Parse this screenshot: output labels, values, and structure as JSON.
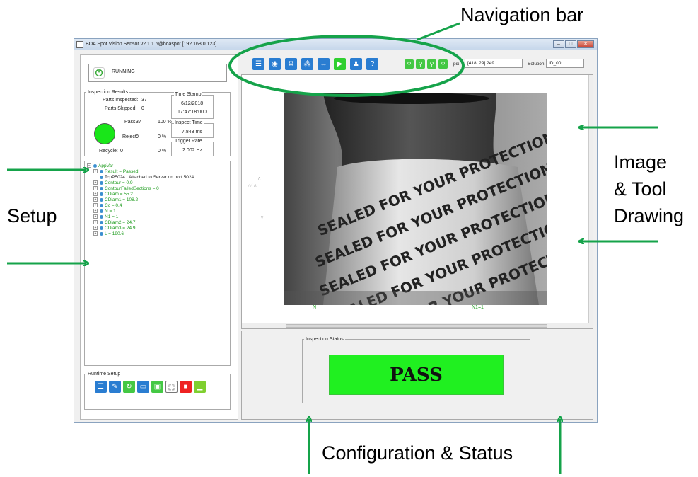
{
  "annotations": {
    "nav_bar": "Navigation bar",
    "setup": "Setup",
    "image_line1": "Image",
    "image_line2": "& Tool",
    "image_line3": "Drawing",
    "config": "Configuration & Status"
  },
  "window": {
    "title": "BOA Spot Vision Sensor v2.1.1.6@boaspot [192.168.0.123]"
  },
  "run": {
    "status": "RUNNING"
  },
  "inspection_results": {
    "legend": "Inspection Results",
    "parts_inspected_label": "Parts Inspected:",
    "parts_inspected": "37",
    "parts_skipped_label": "Parts Skipped:",
    "parts_skipped": "0",
    "pass_label": "Pass:",
    "pass_count": "37",
    "pass_pct": "100 %",
    "reject_label": "Reject:",
    "reject_count": "0",
    "reject_pct": "0 %",
    "recycle_label": "Recycle:",
    "recycle_count": "0",
    "recycle_pct": "0 %",
    "status_color": "#19e619",
    "timestamp_label": "Time Stamp",
    "timestamp_date": "6/12/2018",
    "timestamp_time": "17:47:18:000",
    "inspect_time_label": "Inspect Time",
    "inspect_time": "7.843 ms",
    "trigger_rate_label": "Trigger Rate",
    "trigger_rate": "2.002 Hz"
  },
  "tree": {
    "root": "AppVar",
    "items": [
      "Result = Passed",
      "TcpP5024 : Attached to Server on port 5024",
      "Contour = 0.9",
      "ContourFailedSections = 0",
      "CDiam = 55.2",
      "CDiam1 = 108.2",
      "Cc = 0.4",
      "N = 1",
      "N1 = 1",
      "CDiam2 = 24.7",
      "CDiam3 = 24.9",
      "L = 190.6"
    ]
  },
  "runtime_setup": {
    "legend": "Runtime Setup"
  },
  "toolbar": {
    "pix_label": "pix",
    "pix_value": "[418, 29] 249",
    "solution_label": "Solution",
    "solution_value": "ID_00",
    "nav_icons": [
      "list-icon",
      "eye-icon",
      "gear-icon",
      "hierarchy-icon",
      "connection-icon",
      "play-icon",
      "user-icon",
      "help-icon"
    ],
    "zoom_icons": [
      "zoom-fit-icon",
      "zoom-in-icon",
      "zoom-out-icon",
      "zoom-reset-icon"
    ]
  },
  "image": {
    "label_left": "N",
    "label_right": "N1=1",
    "bottle_text": "SEALED FOR YOUR PROTECTION"
  },
  "inspection_status": {
    "legend": "Inspection Status",
    "result": "PASS",
    "result_color": "#20f020"
  }
}
